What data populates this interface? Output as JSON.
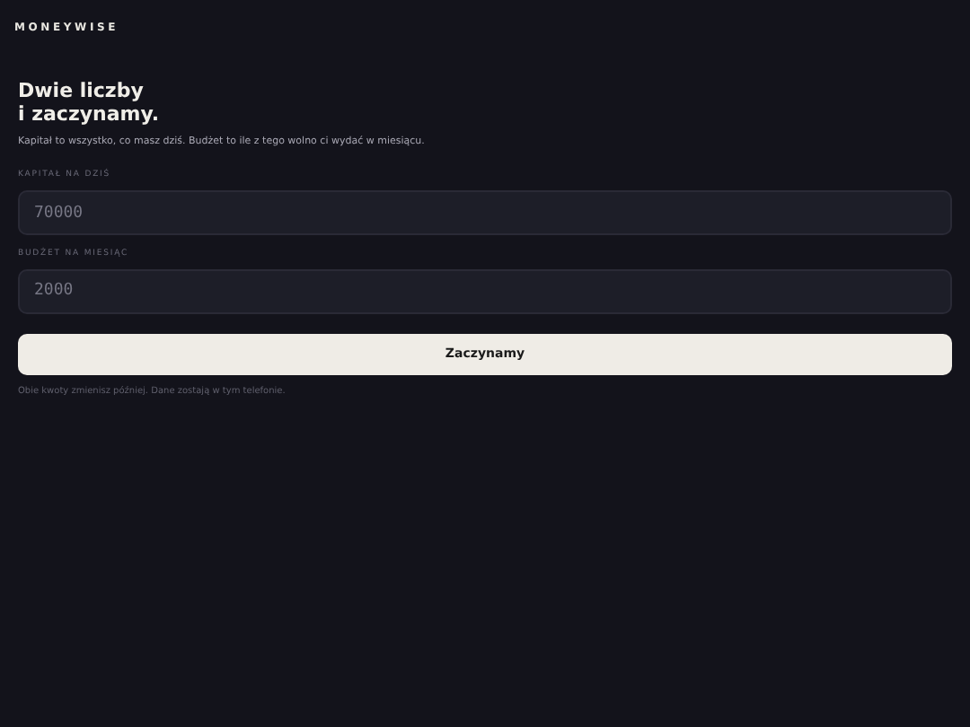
{
  "brand": "MONEYWISE",
  "heading": [
    "Dwie liczby",
    "i zaczynamy."
  ],
  "subtitle": "Kapitał to wszystko, co masz dziś. Budżet to ile z tego wolno ci wydać w miesiącu.",
  "fields": [
    {
      "label": "KAPITAŁ NA DZIŚ",
      "placeholder": "70000"
    },
    {
      "label": "BUDŻET NA MIESIĄC",
      "placeholder": "2000"
    }
  ],
  "button": "Zaczynamy",
  "footnote": "Obie kwoty zmienisz później. Dane zostają w tym telefonie."
}
